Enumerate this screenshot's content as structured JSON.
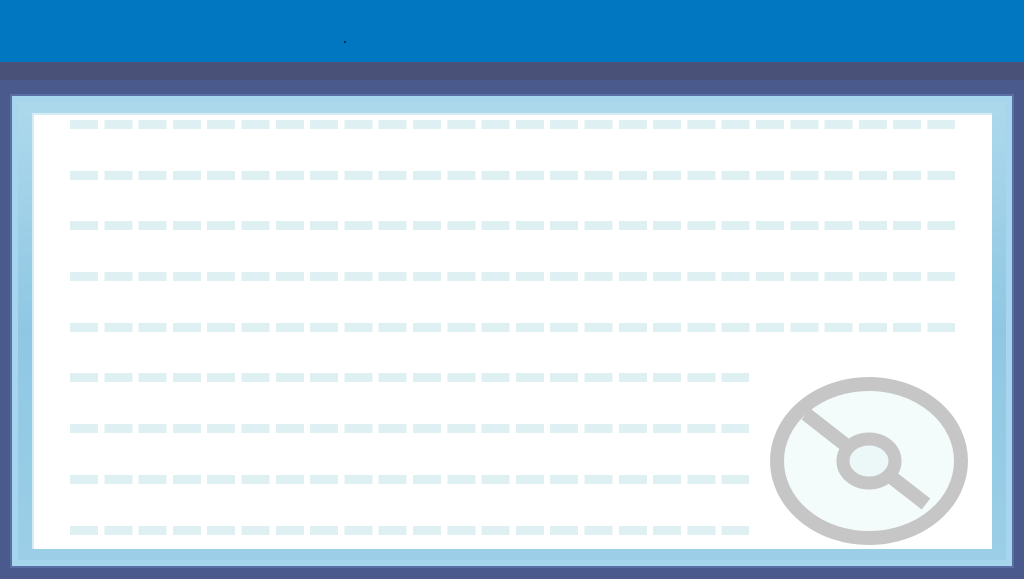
{
  "screen": "text-box",
  "colors": {
    "header": "#0077c0",
    "strip": "#4a5178",
    "frame": "#8fc7e3",
    "paper": "#ffffff",
    "ruled_line": "#dff0f3",
    "emblem": "#c8c8c8"
  },
  "text_lines": [
    "",
    "",
    "",
    "",
    "",
    "",
    "",
    "",
    ""
  ],
  "emblem_icon": "pokeball-icon"
}
